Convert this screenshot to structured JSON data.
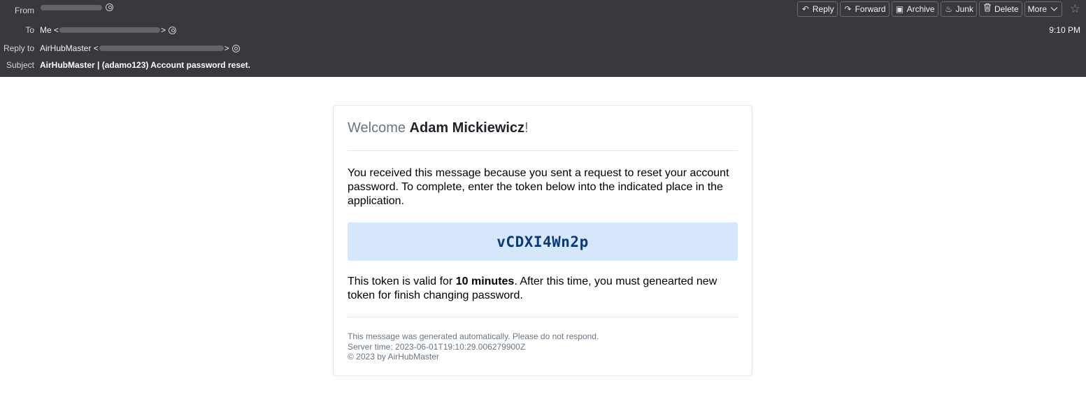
{
  "header": {
    "from_label": "From",
    "to_label": "To",
    "to_name": "Me <",
    "to_suffix": ">",
    "reply_to_label": "Reply to",
    "reply_to_name": "AirHubMaster <",
    "reply_to_suffix": ">",
    "subject_label": "Subject",
    "subject": "AirHubMaster | (adamo123) Account password reset.",
    "time": "9:10 PM"
  },
  "toolbar": {
    "reply": "Reply",
    "forward": "Forward",
    "archive": "Archive",
    "junk": "Junk",
    "delete": "Delete",
    "more": "More"
  },
  "icons": {
    "reply": "reply-icon",
    "forward": "forward-icon",
    "archive": "archive-icon",
    "junk": "junk-icon",
    "delete": "trash-icon",
    "more": "chevron-down-icon",
    "star": "star-icon",
    "contact": "contact-icon"
  },
  "message": {
    "welcome_prefix": "Welcome ",
    "welcome_name": "Adam Mickiewicz",
    "welcome_suffix": "!",
    "intro": "You received this message because you sent a request to reset your account password. To complete, enter the token below into the indicated place in the application.",
    "token": "vCDXI4Wn2p",
    "validity_prefix": "This token is valid for ",
    "validity_duration": "10 minutes",
    "validity_suffix": ". After this time, you must genearted new token for finish changing password.",
    "footer_auto": "This message was generated automatically. Please do not respond.",
    "footer_server_time": "Server time: 2023-06-01T19:10:29.006279900Z",
    "footer_copyright": "© 2023 by AirHubMaster"
  },
  "colors": {
    "header_bg": "#38383d",
    "token_bg": "#d6e6fb",
    "token_text": "#0b3a7a",
    "muted_text": "#6b7484"
  }
}
